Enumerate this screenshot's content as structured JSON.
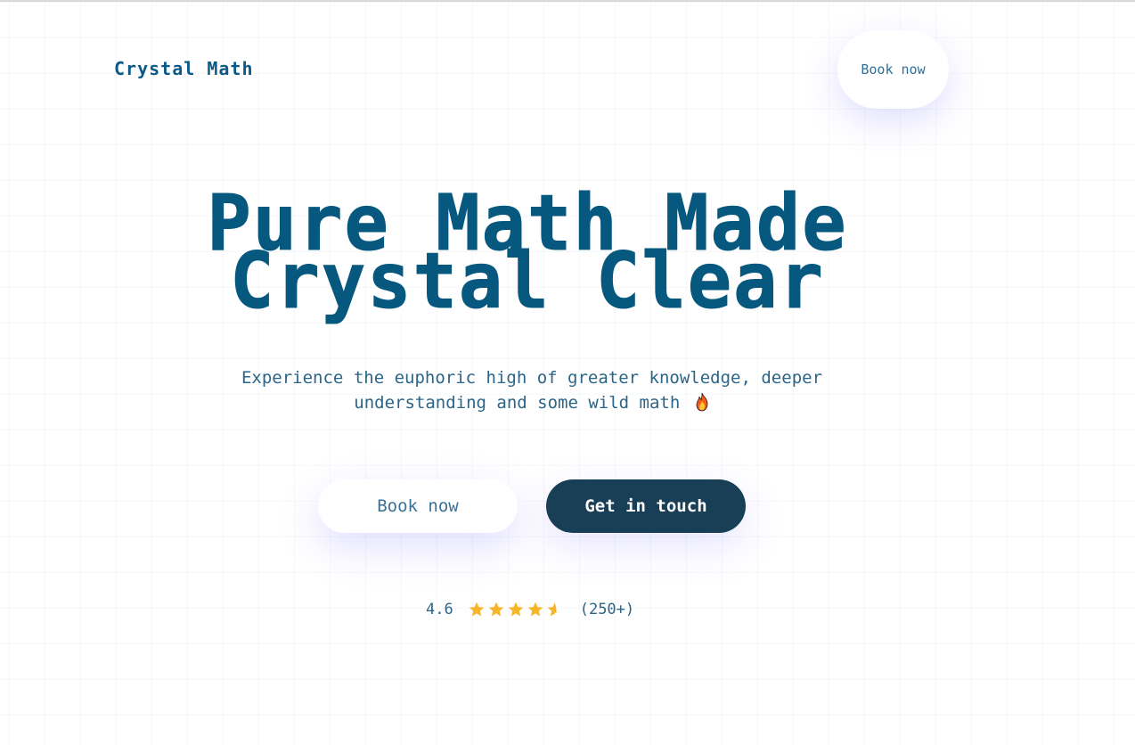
{
  "brand": {
    "name": "Crystal Math"
  },
  "nav": {
    "book_label": "Book now"
  },
  "hero": {
    "title_line1": "Pure Math Made",
    "title_line2": "Crystal Clear",
    "subtitle_line1": "Experience the euphoric high of greater knowledge, deeper",
    "subtitle_line2": "understanding and some wild math",
    "subtitle_icon": "fire-icon"
  },
  "cta": {
    "book_label": "Book now",
    "contact_label": "Get in touch"
  },
  "rating": {
    "value": "4.6",
    "score": 4.6,
    "max": 5,
    "count": "(250+)",
    "star_icon": "star-icon"
  },
  "colors": {
    "brand_blue": "#07587f",
    "dark_button": "#183f56",
    "star_gold": "#f7b62a",
    "glow": "#786eff"
  }
}
